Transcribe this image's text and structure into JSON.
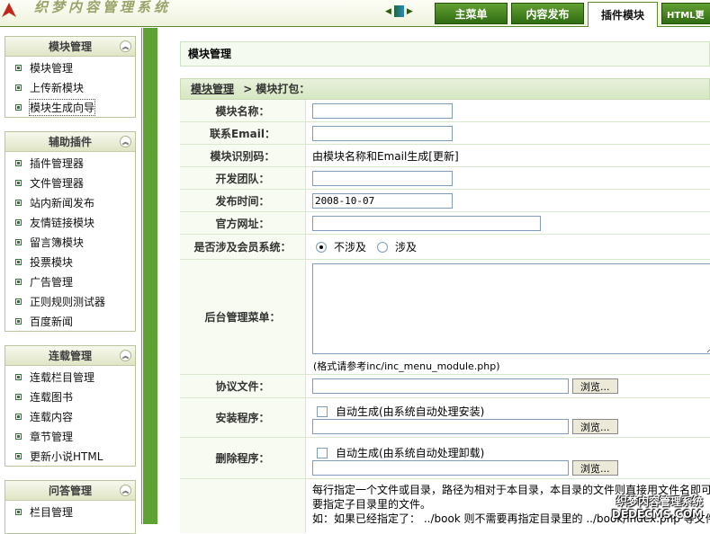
{
  "header": {
    "logo_text": "织梦内容管理系统",
    "tabs": [
      "主菜单",
      "内容发布",
      "插件模块",
      "HTML更"
    ]
  },
  "sidebar": {
    "sections": [
      {
        "title": "模块管理",
        "items": [
          "模块管理",
          "上传新模块",
          "模块生成向导"
        ]
      },
      {
        "title": "辅助插件",
        "items": [
          "插件管理器",
          "文件管理器",
          "站内新闻发布",
          "友情链接模块",
          "留言簿模块",
          "投票模块",
          "广告管理",
          "正则规则测试器",
          "百度新闻"
        ]
      },
      {
        "title": "连载管理",
        "items": [
          "连载栏目管理",
          "连载图书",
          "连载内容",
          "章节管理",
          "更新小说HTML"
        ]
      },
      {
        "title": "问答管理",
        "items": [
          "栏目管理"
        ]
      }
    ]
  },
  "main": {
    "page_title": "模块管理",
    "breadcrumb_link": "模块管理",
    "breadcrumb_sep": "> 模块打包：",
    "fields": {
      "name_label": "模块名称：",
      "email_label": "联系Email：",
      "hash_label": "模块识别码：",
      "hash_value": "由模块名称和Email生成[更新]",
      "team_label": "开发团队：",
      "date_label": "发布时间：",
      "date_value": "2008-10-07",
      "site_label": "官方网址：",
      "member_label": "是否涉及会员系统：",
      "member_opt_no": "不涉及",
      "member_opt_yes": "涉及",
      "menu_label": "后台管理菜单：",
      "menu_hint": "(格式请参考inc/inc_menu_module.php)",
      "license_label": "协议文件：",
      "browse": "浏览...",
      "setup_label": "安装程序：",
      "setup_auto": "自动生成(由系统自动处理安装)",
      "uninstall_label": "删除程序：",
      "uninstall_auto": "自动生成(由系统自动处理卸载)",
      "filelist_text1": "每行指定一个文件或目录，路径为相对于本目录，本目录的文件则直接用文件名即可，",
      "filelist_text2": "要指定子目录里的文件。",
      "filelist_text3": "如：如果已经指定了： ../book 则不需要再指定目录里的 ../book/index.php 等文件"
    }
  },
  "watermark": {
    "line1": "织梦内容管理系统",
    "line2": "DEDECMS.COM"
  }
}
